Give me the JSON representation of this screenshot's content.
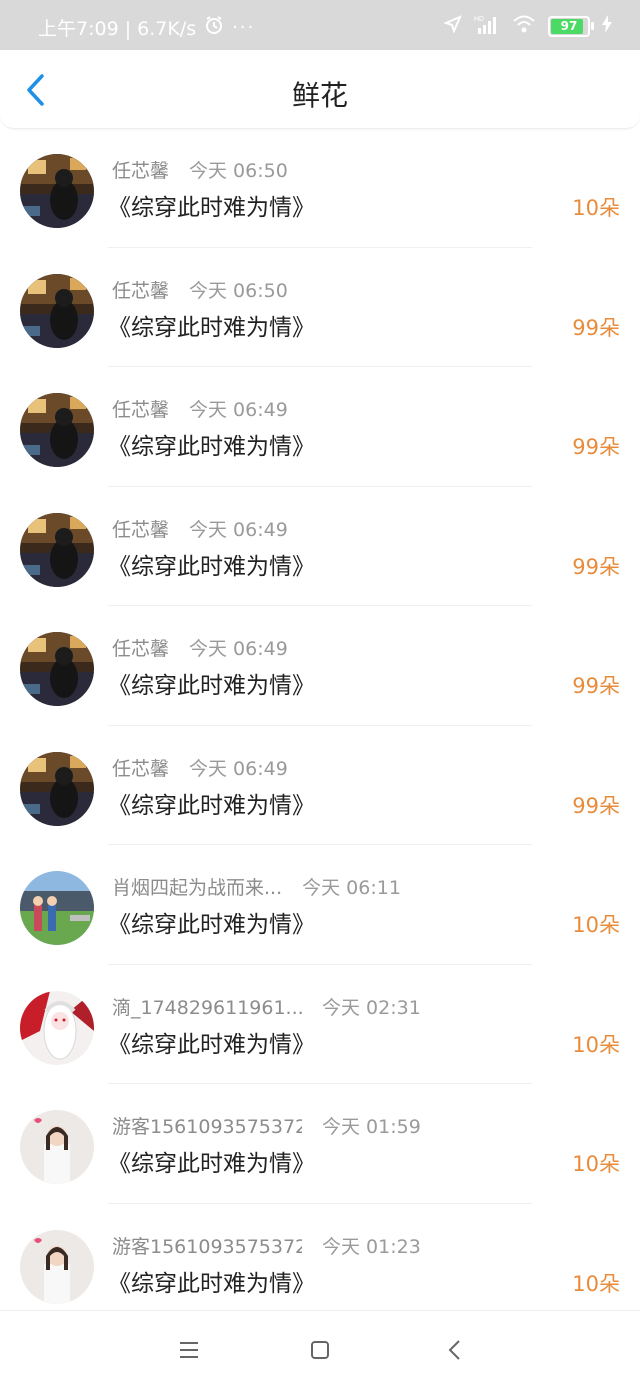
{
  "status_bar": {
    "time_speed": "上午7:09 | 6.7K/s",
    "battery": "97",
    "icons": [
      "alarm-icon",
      "more-dots-icon",
      "location-icon",
      "hd-signal-icon",
      "wifi-icon",
      "battery-icon",
      "charging-icon"
    ]
  },
  "header": {
    "title": "鲜花",
    "back_icon": "chevron-left-icon"
  },
  "colors": {
    "accent_blue": "#1e90e6",
    "count_orange": "#e88c3c",
    "battery_green": "#4cd964"
  },
  "rows": [
    {
      "name": "任芯馨",
      "time": "今天 06:50",
      "book": "《综穿此时难为情》",
      "count": "10朵",
      "avatar": "room-avatar"
    },
    {
      "name": "任芯馨",
      "time": "今天 06:50",
      "book": "《综穿此时难为情》",
      "count": "99朵",
      "avatar": "room-avatar"
    },
    {
      "name": "任芯馨",
      "time": "今天 06:49",
      "book": "《综穿此时难为情》",
      "count": "99朵",
      "avatar": "room-avatar"
    },
    {
      "name": "任芯馨",
      "time": "今天 06:49",
      "book": "《综穿此时难为情》",
      "count": "99朵",
      "avatar": "room-avatar"
    },
    {
      "name": "任芯馨",
      "time": "今天 06:49",
      "book": "《综穿此时难为情》",
      "count": "99朵",
      "avatar": "room-avatar"
    },
    {
      "name": "任芯馨",
      "time": "今天 06:49",
      "book": "《综穿此时难为情》",
      "count": "99朵",
      "avatar": "room-avatar"
    },
    {
      "name": "肖烟四起为战而来...",
      "time": "今天 06:11",
      "book": "《综穿此时难为情》",
      "count": "10朵",
      "avatar": "game-avatar"
    },
    {
      "name": "滴_174829611961...",
      "time": "今天 02:31",
      "book": "《综穿此时难为情》",
      "count": "10朵",
      "avatar": "anime-avatar"
    },
    {
      "name": "游客1561093575372",
      "time": "今天 01:59",
      "book": "《综穿此时难为情》",
      "count": "10朵",
      "avatar": "girl-avatar"
    },
    {
      "name": "游客1561093575372",
      "time": "今天 01:23",
      "book": "《综穿此时难为情》",
      "count": "10朵",
      "avatar": "girl-avatar"
    }
  ],
  "nav_bar": {
    "buttons": [
      "menu-icon",
      "home-square-icon",
      "back-triangle-icon"
    ]
  }
}
